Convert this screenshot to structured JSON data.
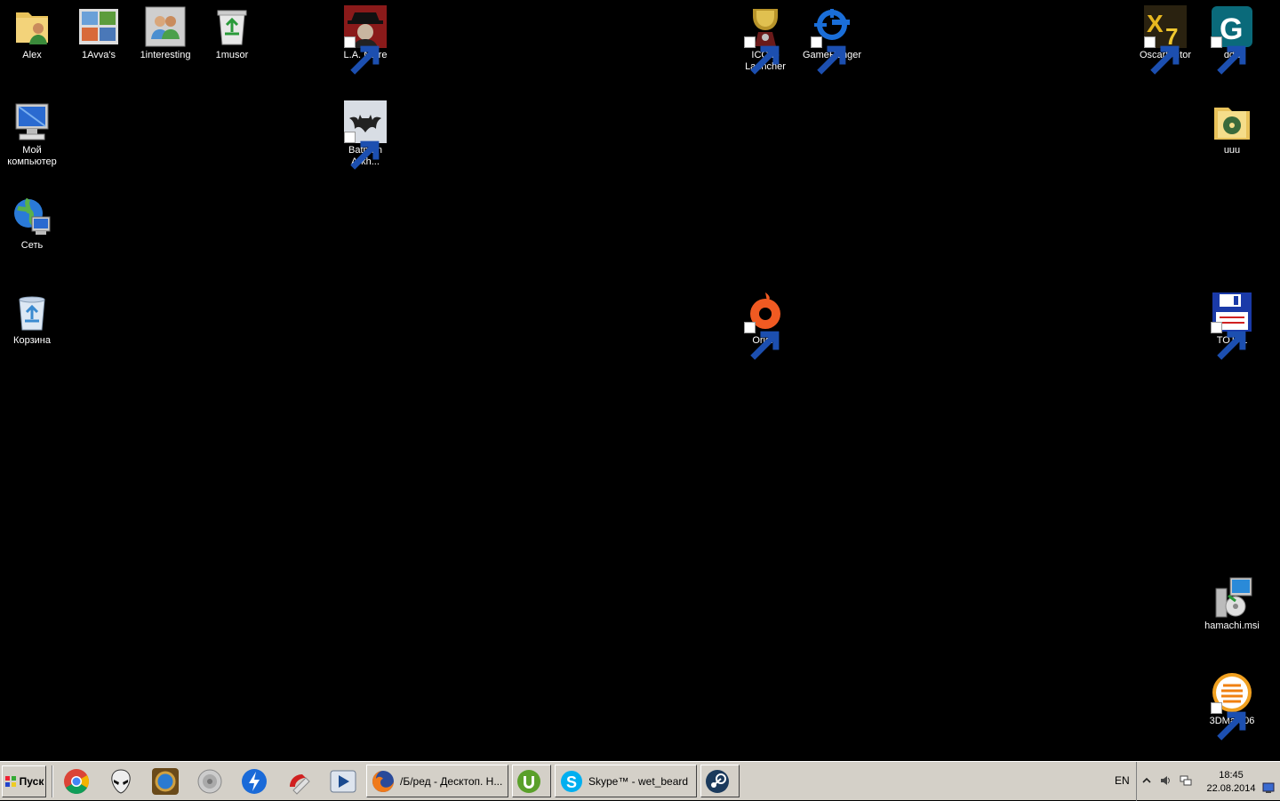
{
  "desktop": {
    "icons": [
      {
        "label": "Alex",
        "icon": "user-folder-icon"
      },
      {
        "label": "1Avva's",
        "icon": "pictures-folder-icon"
      },
      {
        "label": "1interesting",
        "icon": "users-folder-icon"
      },
      {
        "label": "1musor",
        "icon": "recycle-folder-icon"
      },
      {
        "label": "L.A. Noire",
        "icon": "la-noire-icon"
      },
      {
        "label": "ICCup Launcher",
        "icon": "iccup-icon"
      },
      {
        "label": "GameRanger",
        "icon": "gameranger-icon"
      },
      {
        "label": "OscarEditor",
        "icon": "oscar-editor-icon"
      },
      {
        "label": "ddd",
        "icon": "g-app-icon"
      },
      {
        "label": "Мой компьютер",
        "icon": "my-computer-icon"
      },
      {
        "label": "Batman Arkh...",
        "icon": "batman-icon"
      },
      {
        "label": "uuu",
        "icon": "music-folder-icon"
      },
      {
        "label": "Сеть",
        "icon": "network-icon"
      },
      {
        "label": "Корзина",
        "icon": "recycle-bin-icon"
      },
      {
        "label": "Origin",
        "icon": "origin-icon"
      },
      {
        "label": "TOTAL",
        "icon": "total-commander-icon"
      },
      {
        "label": "hamachi.msi",
        "icon": "msi-installer-icon"
      },
      {
        "label": "3DMark06",
        "icon": "3dmark-icon"
      }
    ]
  },
  "taskbar": {
    "start_label": "Пуск",
    "quick_launch": [
      "chrome-icon",
      "alien-icon",
      "hearthstone-icon",
      "speaker-icon",
      "thunder-icon",
      "ccleaner-icon",
      "media-player-icon"
    ],
    "tasks": [
      {
        "label": "/Б/ред - Десктоп. Н...",
        "icon": "firefox-icon"
      },
      {
        "label": "",
        "icon": "utorrent-icon"
      },
      {
        "label": "Skype™ - wet_beard",
        "icon": "skype-icon"
      },
      {
        "label": "",
        "icon": "steam-icon"
      }
    ],
    "tray": {
      "language": "EN",
      "time": "18:45",
      "date": "22.08.2014"
    }
  },
  "colors": {
    "desktop_bg": "#000000",
    "taskbar_bg": "#d4d0c8",
    "origin_orange": "#f05a22",
    "skype_blue": "#00aff0"
  }
}
